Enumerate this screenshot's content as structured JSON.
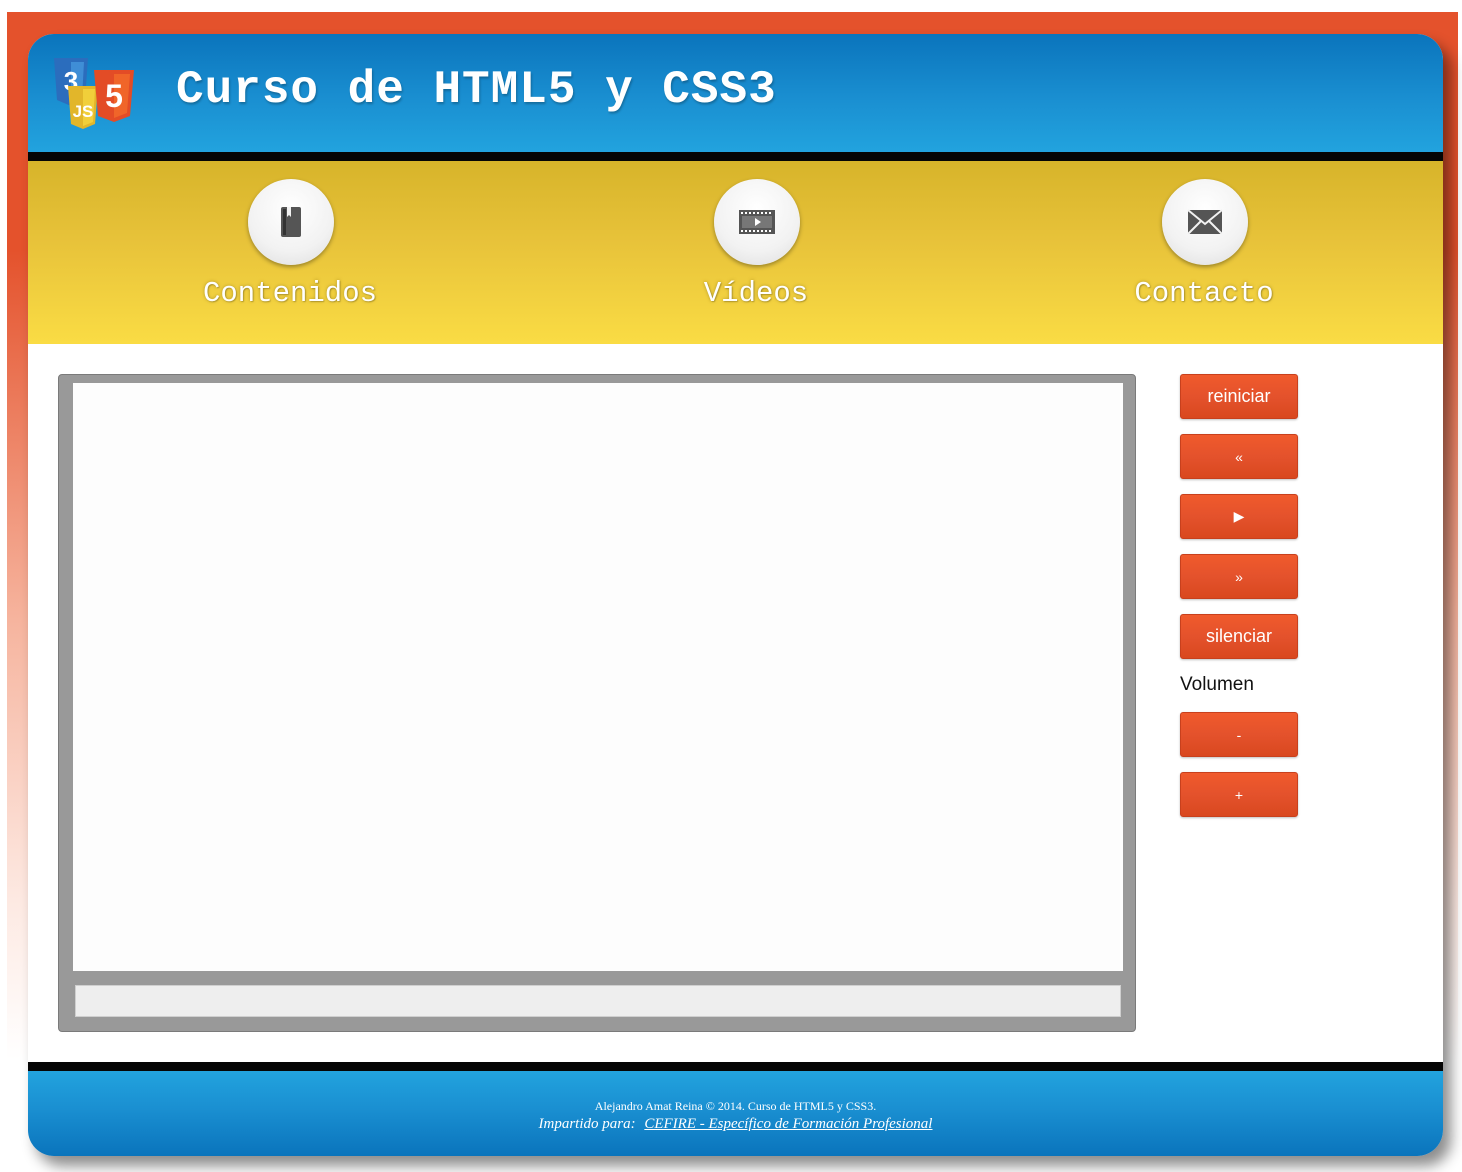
{
  "header": {
    "title": "Curso de HTML5 y CSS3",
    "logo": {
      "icon": "css3-js-html5-logo",
      "glyphs": [
        "3",
        "JS",
        "5"
      ]
    }
  },
  "nav": {
    "items": [
      {
        "label": "Contenidos",
        "icon": "book-icon"
      },
      {
        "label": "Vídeos",
        "icon": "film-icon"
      },
      {
        "label": "Contacto",
        "icon": "envelope-icon"
      }
    ]
  },
  "player": {
    "progress": 0
  },
  "controls": {
    "restart_label": "reiniciar",
    "rewind_label": "«",
    "play_label": "▶",
    "forward_label": "»",
    "mute_label": "silenciar",
    "volume_label": "Volumen",
    "volume_down_label": "-",
    "volume_up_label": "+"
  },
  "footer": {
    "credit": "Alejandro Amat Reina © 2014. Curso de HTML5 y CSS3.",
    "taught_for": "Impartido para:",
    "link_text": "CEFIRE - Específico de Formación Profesional"
  },
  "colors": {
    "header_blue": "#1a8fd1",
    "nav_yellow": "#fadc44",
    "accent_orange": "#e4522c",
    "player_gray": "#999999"
  }
}
